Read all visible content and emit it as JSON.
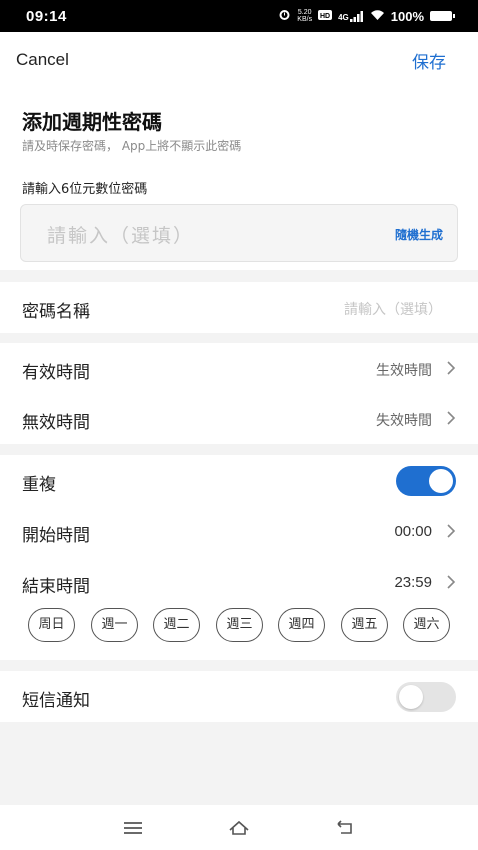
{
  "status_bar": {
    "time": "09:14",
    "net_speed_value": "5.20",
    "net_speed_unit": "KB/s",
    "signal": "4G",
    "battery": "100%"
  },
  "header": {
    "cancel_label": "Cancel",
    "save_label": "保存"
  },
  "intro": {
    "title": "添加週期性密碼",
    "subtitle": "請及時保存密碼， App上將不顯示此密碼"
  },
  "password": {
    "label": "請輸入6位元數位密碼",
    "placeholder": "請輸入（選填）",
    "random_label": "隨機生成"
  },
  "name_row": {
    "label": "密碼名稱",
    "placeholder": "請輸入（選填）"
  },
  "valid_time": {
    "label": "有效時間",
    "value": "生效時間"
  },
  "invalid_time": {
    "label": "無效時間",
    "value": "失效時間"
  },
  "repeat": {
    "label": "重複",
    "enabled": true
  },
  "start_time": {
    "label": "開始時間",
    "value": "00:00"
  },
  "end_time": {
    "label": "結束時間",
    "value": "23:59"
  },
  "weekdays": [
    "周日",
    "週一",
    "週二",
    "週三",
    "週四",
    "週五",
    "週六"
  ],
  "sms": {
    "label": "短信通知",
    "enabled": false
  },
  "colors": {
    "accent": "#1f6fd0",
    "background": "#f3f3f3"
  }
}
